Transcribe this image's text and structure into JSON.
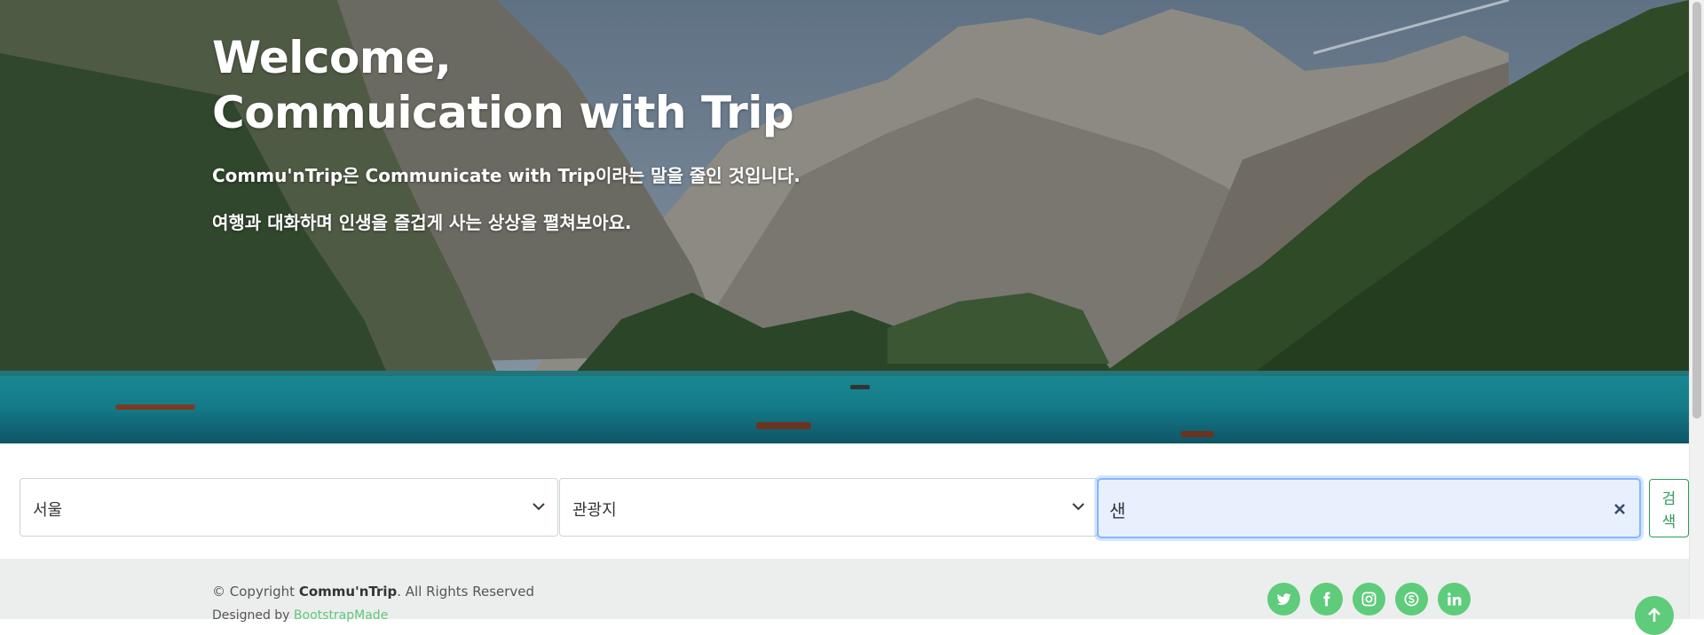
{
  "hero": {
    "title_line1": "Welcome,",
    "title_line2": "Commuication with Trip",
    "subtitle1": "Commu'nTrip은 Communicate with Trip이라는 말을 줄인 것입니다.",
    "subtitle2": "여행과 대화하며 인생을 즐겁게 사는 상상을 펼쳐보아요."
  },
  "search": {
    "region_value": "서울",
    "category_value": "관광지",
    "keyword_value": "샌",
    "button_label": "검색"
  },
  "footer": {
    "copyright_prefix": "© Copyright ",
    "brand": "Commu'nTrip",
    "copyright_suffix": ". All Rights Reserved",
    "designed_prefix": "Designed by ",
    "designer": "BootstrapMade"
  },
  "social_icons": [
    "twitter-icon",
    "facebook-icon",
    "instagram-icon",
    "skype-icon",
    "linkedin-icon"
  ],
  "colors": {
    "accent_green": "#5ecc7b",
    "button_green": "#2e9a5e",
    "focus_blue": "#86b7fe",
    "footer_bg": "#eceeed"
  }
}
